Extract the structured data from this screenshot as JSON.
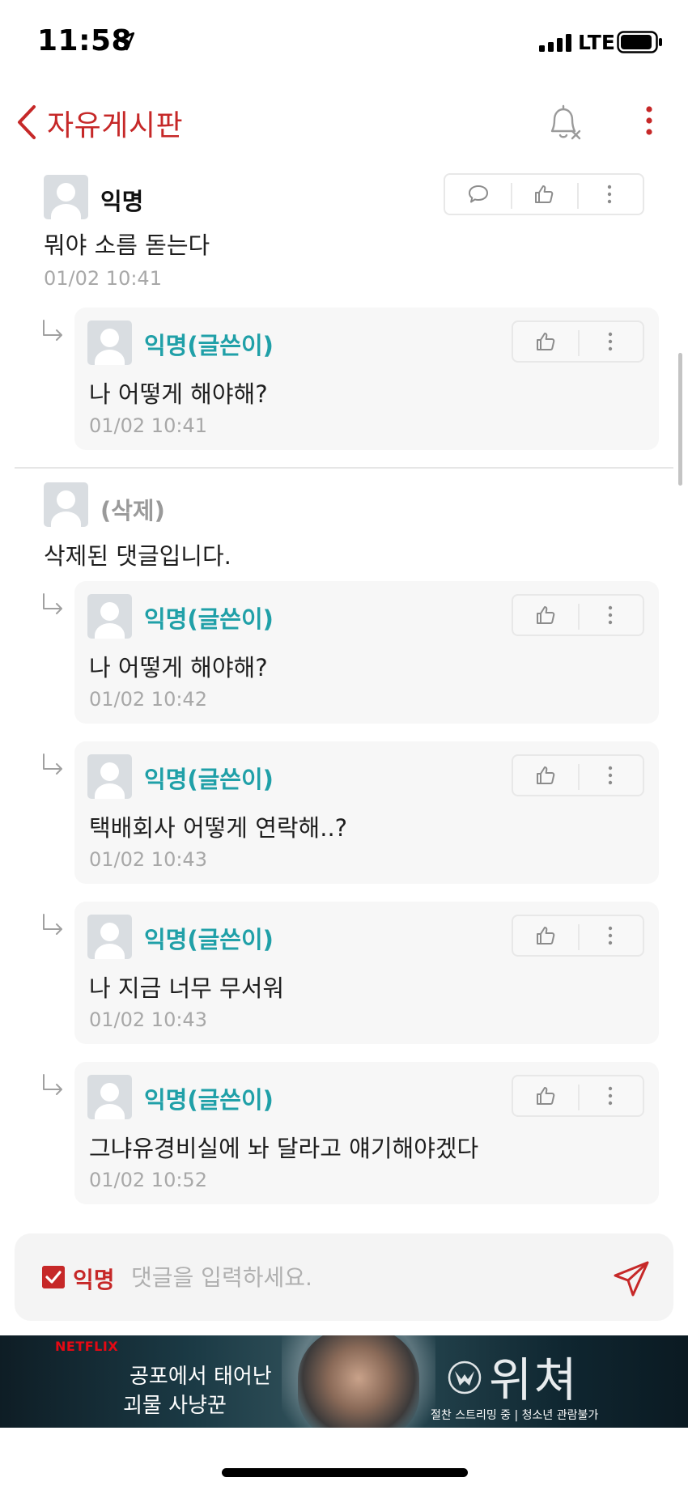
{
  "status_bar": {
    "time": "11:58",
    "network": "LTE"
  },
  "header": {
    "title": "자유게시판"
  },
  "comments": [
    {
      "author": "익명",
      "text": "뭐야 소름 돋는다",
      "time": "01/02 10:41",
      "replies": [
        {
          "author": "익명(글쓴이)",
          "text": "나 어떻게 해야해?",
          "time": "01/02 10:41"
        }
      ]
    },
    {
      "author": "(삭제)",
      "text": "삭제된 댓글입니다.",
      "replies": [
        {
          "author": "익명(글쓴이)",
          "text": "나 어떻게 해야해?",
          "time": "01/02 10:42"
        },
        {
          "author": "익명(글쓴이)",
          "text": "택배회사 어떻게 연락해..?",
          "time": "01/02 10:43"
        },
        {
          "author": "익명(글쓴이)",
          "text": "나 지금 너무 무서워",
          "time": "01/02 10:43"
        },
        {
          "author": "익명(글쓴이)",
          "text": "그냐유경비실에 놔 달라고 얘기해야겠다",
          "time": "01/02 10:52"
        }
      ]
    }
  ],
  "input": {
    "anonymous_label": "익명",
    "anonymous_checked": true,
    "placeholder": "댓글을 입력하세요."
  },
  "ad": {
    "brand": "NETFLIX",
    "tagline_1": "공포에서 태어난",
    "tagline_2": "괴물 사냥꾼",
    "title": "위쳐",
    "subtitle": "절찬 스트리밍 중 | 청소년 관람불가"
  },
  "colors": {
    "accent": "#c62828",
    "author_highlight": "#20a0a8",
    "muted": "#a8a8a8"
  },
  "icons": [
    "location-arrow-icon",
    "signal-icon",
    "battery-icon",
    "back-chevron-icon",
    "bell-off-icon",
    "more-vertical-icon",
    "comment-icon",
    "thumbs-up-icon",
    "reply-arrow-icon",
    "checkbox-icon",
    "send-icon",
    "witcher-emblem-icon"
  ]
}
